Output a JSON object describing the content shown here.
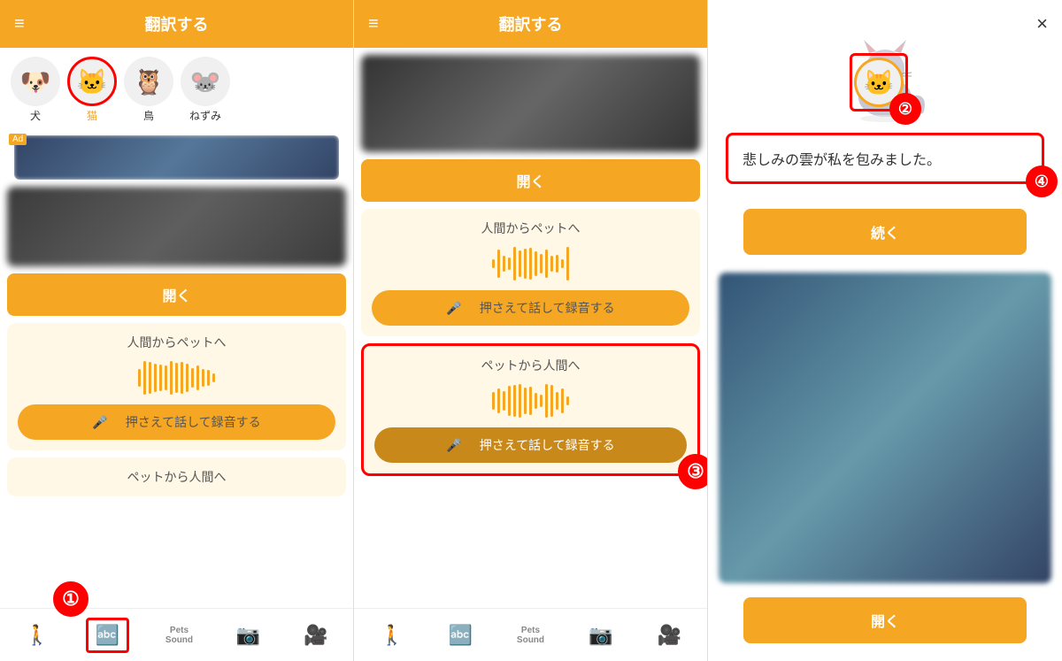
{
  "panel1": {
    "header_title": "翻訳する",
    "menu_icon": "≡",
    "pets": [
      {
        "emoji": "🐶",
        "label": "犬",
        "selected": false
      },
      {
        "emoji": "🐱",
        "label": "猫",
        "selected": true
      },
      {
        "emoji": "🦉",
        "label": "鳥",
        "selected": false
      },
      {
        "emoji": "🐭",
        "label": "ねずみ",
        "selected": false
      }
    ],
    "ad_label": "Ad",
    "open_button": "開く",
    "section1_title": "人間からペットへ",
    "record_button": "　押さえて話して録音する",
    "section2_title": "ペットから人間へ",
    "step1_number": "①"
  },
  "panel2": {
    "header_title": "翻訳する",
    "menu_icon": "≡",
    "open_button": "開く",
    "section1_title": "人間からペットへ",
    "record_button1": "　押さえて話して録音する",
    "section2_title": "ペットから人間へ",
    "record_button2": "　押さえて話して録音する",
    "step3_number": "③"
  },
  "panel3": {
    "close_icon": "×",
    "translation_text": "悲しみの雲が私を包みました。",
    "continue_button": "続く",
    "open_button": "開く",
    "step4_number": "④",
    "step2_number": "②"
  },
  "nav": {
    "items": [
      {
        "icon": "🚶",
        "label": "",
        "active": false
      },
      {
        "icon": "🔤",
        "label": "",
        "active": true
      },
      {
        "icon": "Pets\nSound",
        "label": "",
        "active": false,
        "is_pets_sound": true
      },
      {
        "icon": "📷",
        "label": "",
        "active": false
      },
      {
        "icon": "🎥",
        "label": "",
        "active": false
      }
    ]
  }
}
